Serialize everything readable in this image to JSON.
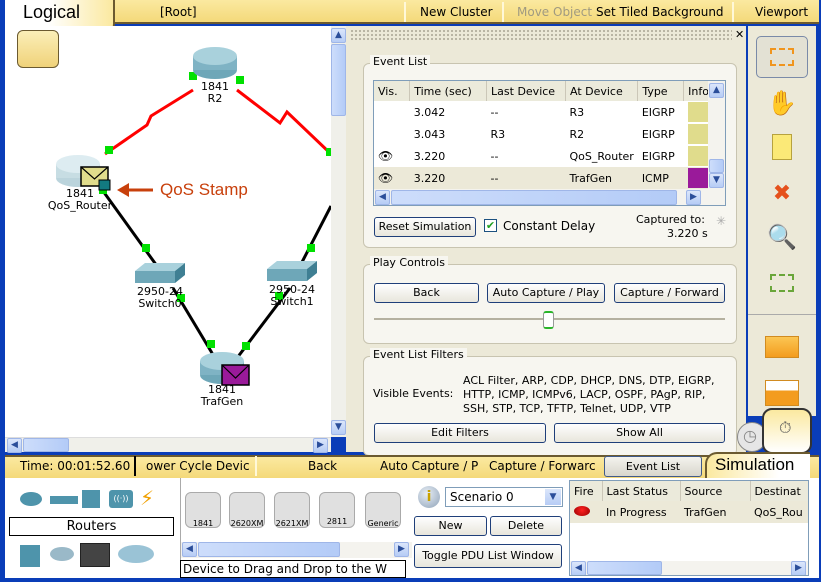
{
  "top_toolbar": {
    "view_tab": "Logical",
    "path": "[Root]",
    "new_cluster": "New Cluster",
    "move_object": "Move Object",
    "set_tiled_background": "Set Tiled Background",
    "viewport": "Viewport"
  },
  "topology": {
    "devices": [
      {
        "model": "1841",
        "name": "R2",
        "type": "router"
      },
      {
        "model": "1841",
        "name": "QoS_Router",
        "type": "router"
      },
      {
        "model": "2950-24",
        "name": "Switch0",
        "type": "switch"
      },
      {
        "model": "2950-24",
        "name": "Switch1",
        "type": "switch"
      },
      {
        "model": "1841",
        "name": "TrafGen",
        "type": "router"
      }
    ],
    "annotation": "QoS Stamp",
    "colors": {
      "serial_link": "#ff0000",
      "ethernet_link": "#000000",
      "port_up": "#00e000",
      "eigrp_pdu": "#e0dc8c",
      "icmp_pdu": "#9a1a9a",
      "annotation": "#c8400c"
    }
  },
  "event_list": {
    "title": "Event List",
    "columns": [
      "Vis.",
      "Time (sec)",
      "Last Device",
      "At Device",
      "Type",
      "Info"
    ],
    "rows": [
      {
        "visible": false,
        "time": "3.042",
        "last_device": "--",
        "at_device": "R3",
        "type": "EIGRP",
        "color": "#e0dc8c"
      },
      {
        "visible": false,
        "time": "3.043",
        "last_device": "R3",
        "at_device": "R2",
        "type": "EIGRP",
        "color": "#e0dc8c"
      },
      {
        "visible": true,
        "time": "3.220",
        "last_device": "--",
        "at_device": "QoS_Router",
        "type": "EIGRP",
        "color": "#e0dc8c"
      },
      {
        "visible": true,
        "time": "3.220",
        "last_device": "--",
        "at_device": "TrafGen",
        "type": "ICMP",
        "color": "#9a1a9a",
        "selected": true
      }
    ],
    "reset_simulation": "Reset Simulation",
    "constant_delay": "Constant Delay",
    "constant_delay_checked": true,
    "captured_to_label": "Captured to:",
    "captured_to_value": "3.220 s"
  },
  "play_controls": {
    "title": "Play Controls",
    "back": "Back",
    "auto_capture": "Auto Capture / Play",
    "capture_forward": "Capture / Forward",
    "speed_fraction": 0.5
  },
  "filters": {
    "title": "Event List Filters",
    "visible_events_label": "Visible Events:",
    "line1": "ACL Filter, ARP, CDP, DHCP, DNS, DTP, EIGRP,",
    "line2": "HTTP, ICMP, ICMPv6, LACP, OSPF, PAgP, RIP,",
    "line3": "SSH, STP, TCP, TFTP, Telnet, UDP, VTP",
    "edit_filters": "Edit Filters",
    "show_all": "Show All"
  },
  "bottom_toolbar": {
    "time": "Time: 00:01:52.60",
    "power_cycle": "ower Cycle Devic",
    "back": "Back",
    "auto_capture": "Auto Capture / P",
    "capture_forward": "Capture / Forwarc",
    "event_list": "Event List",
    "mode_tab": "Simulation"
  },
  "device_palette": {
    "category_label": "Routers",
    "models": [
      "1841",
      "2620XM",
      "2621XM",
      "2811",
      "Generic"
    ],
    "hint": "Device to Drag and Drop to the W"
  },
  "scenario": {
    "selected": "Scenario 0",
    "new": "New",
    "delete": "Delete",
    "toggle_pdu": "Toggle PDU List Window"
  },
  "pdu_list": {
    "columns": [
      "Fire",
      "Last Status",
      "Source",
      "Destinat"
    ],
    "rows": [
      {
        "last_status": "In Progress",
        "source": "TrafGen",
        "destination": "QoS_Rou"
      }
    ]
  }
}
